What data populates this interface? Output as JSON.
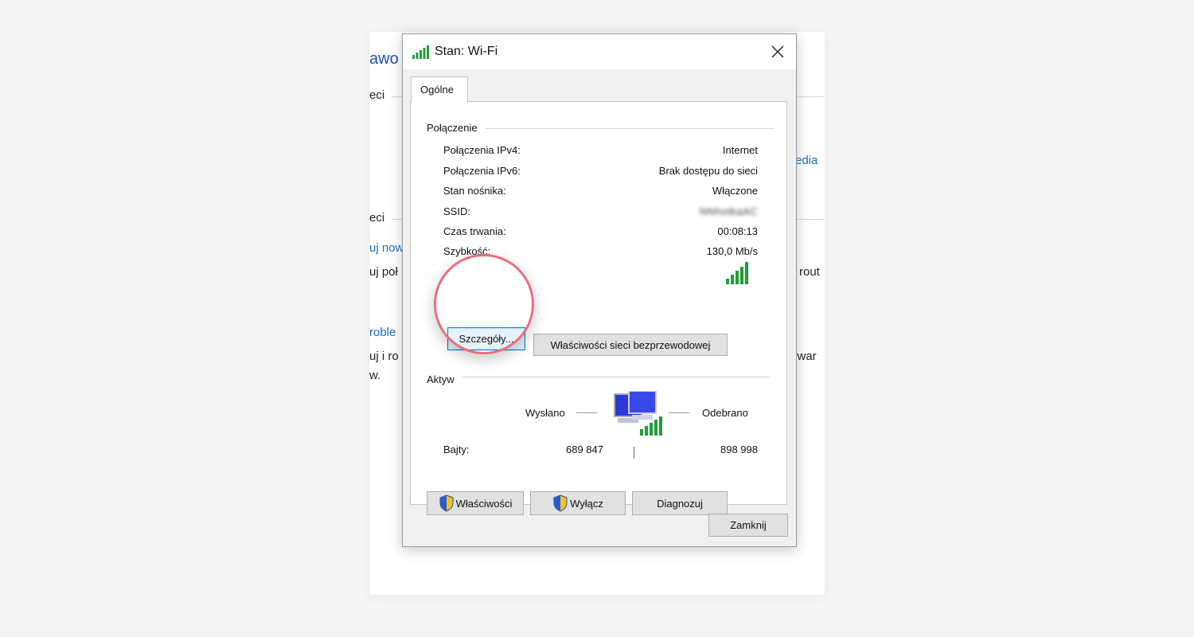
{
  "background_window": {
    "fragments": {
      "title": "awo",
      "section1": "eci",
      "media": "edia",
      "section2": "eci",
      "link1": "uj now",
      "line1": "uj poł",
      "rout": "rout",
      "link2": "roble",
      "line2": "uj i ro",
      "line3": "w.",
      "ywar": "ywar"
    }
  },
  "dialog": {
    "title": "Stan: Wi-Fi",
    "tab": "Ogólne",
    "connection": {
      "heading": "Połączenie",
      "rows": [
        {
          "label": "Połączenia IPv4:",
          "value": "Internet"
        },
        {
          "label": "Połączenia IPv6:",
          "value": "Brak dostępu do sieci"
        },
        {
          "label": "Stan nośnika:",
          "value": "Włączone"
        },
        {
          "label": "SSID:",
          "value": "NNhotkaAC"
        },
        {
          "label": "Czas trwania:",
          "value": "00:08:13"
        },
        {
          "label": "Szybkość:",
          "value": "130,0 Mb/s"
        }
      ],
      "signal_icon": "wifi-signal-bars-icon"
    },
    "buttons": {
      "details": "Szczegóły...",
      "wireless_properties": "Właściwości sieci bezprzewodowej"
    },
    "activity": {
      "heading": "Aktyw",
      "sent_label": "Wysłano",
      "received_label": "Odebrano",
      "bytes_label": "Bajty:",
      "sent_value": "689 847",
      "received_value": "898 998",
      "icon": "network-computers-icon"
    },
    "bottom_buttons": {
      "properties": "Właściwości",
      "disable": "Wyłącz",
      "diagnose": "Diagnozuj"
    },
    "close_button": "Zamknij"
  },
  "colors": {
    "accent_ring": "#e6707e",
    "signal_green": "#1f9e3a",
    "focus_blue": "#0078d7"
  }
}
